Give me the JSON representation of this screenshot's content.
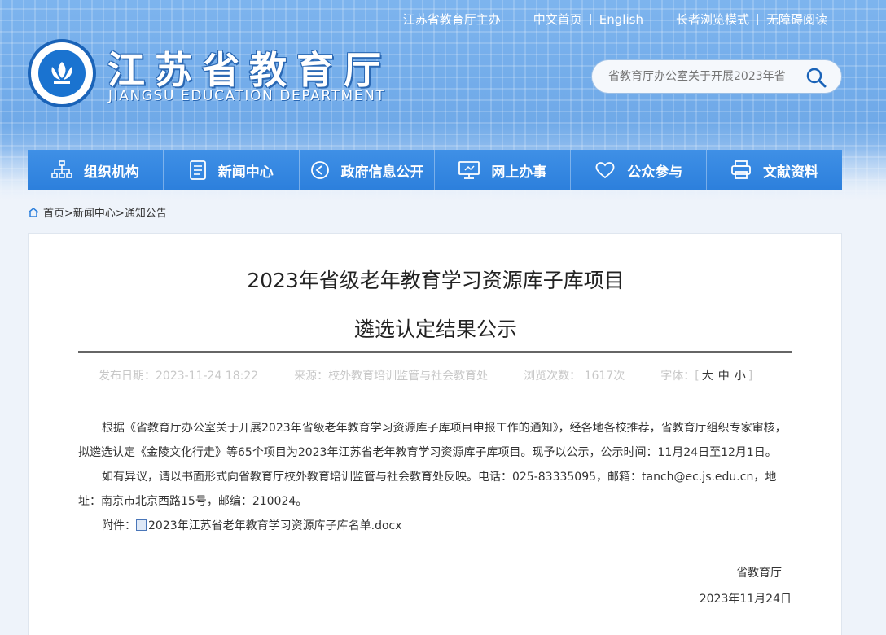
{
  "header": {
    "top_links": [
      "江苏省教育厅主办",
      "中文首页",
      "English",
      "长者浏览模式",
      "无障碍阅读"
    ],
    "site_title": "江苏省教育厅",
    "site_subtitle": "JIANGSU EDUCATION DEPARTMENT",
    "search_placeholder": "省教育厅办公室关于开展2023年省"
  },
  "nav": {
    "items": [
      {
        "label": "组织机构",
        "icon": "org-chart-icon"
      },
      {
        "label": "新闻中心",
        "icon": "document-icon"
      },
      {
        "label": "政府信息公开",
        "icon": "play-circle-icon"
      },
      {
        "label": "网上办事",
        "icon": "monitor-icon"
      },
      {
        "label": "公众参与",
        "icon": "heart-icon"
      },
      {
        "label": "文献资料",
        "icon": "printer-icon"
      }
    ]
  },
  "breadcrumb": {
    "home": "首页>",
    "section": "新闻中心>",
    "current": "通知公告"
  },
  "article": {
    "title_line1": "2023年省级老年教育学习资源库子库项目",
    "title_line2": "遴选认定结果公示",
    "publish_date": "发布日期：2023-11-24 18:22",
    "source": "来源：校外教育培训监管与社会教育处",
    "views": "浏览次数：  1617次",
    "font_label": "字体：",
    "font_open": "[",
    "font_large": "大",
    "font_medium": "中",
    "font_small": "小",
    "font_close": "]",
    "paragraph1": "根据《省教育厅办公室关于开展2023年省级老年教育学习资源库子库项目申报工作的通知》，经各地各校推荐，省教育厅组织专家审核，拟遴选认定《金陵文化行走》等65个项目为2023年江苏省老年教育学习资源库子库项目。现予以公示，公示时间：11月24日至12月1日。",
    "paragraph2": "如有异议，请以书面形式向省教育厅校外教育培训监管与社会教育处反映。电话：025-83335095，邮箱：tanch@ec.js.edu.cn，地址：南京市北京西路15号，邮编：210024。",
    "attachment_label": "附件：",
    "attachment_name": "2023年江苏省老年教育学习资源库子库名单.docx",
    "signature": "省教育厅",
    "sign_date": "2023年11月24日"
  },
  "colors": {
    "nav_bg": "#2c7fdc",
    "banner_bg": "#79b1ec",
    "logo_blue": "#1a63b8"
  }
}
